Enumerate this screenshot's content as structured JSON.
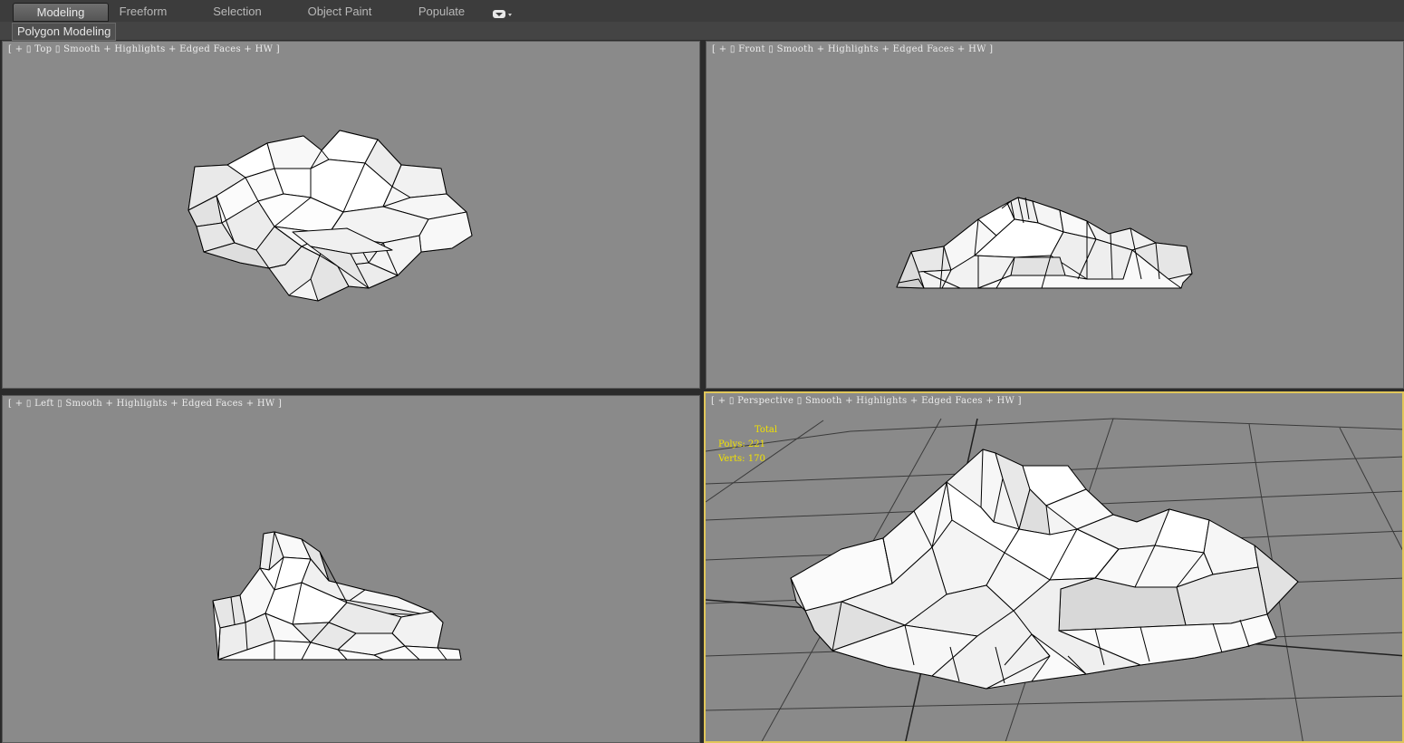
{
  "ribbon": {
    "tabs": [
      "Modeling",
      "Freeform",
      "Selection",
      "Object Paint",
      "Populate"
    ],
    "active_tab": "Modeling",
    "panel_label": "Polygon Modeling",
    "expand_icon": "dropdown-icon"
  },
  "viewports": {
    "top": {
      "bracket_open": "[",
      "plus": "+",
      "name": "Top",
      "shading": "Smooth + Highlights + Edged Faces + HW",
      "bracket_close": "]"
    },
    "front": {
      "bracket_open": "[",
      "plus": "+",
      "name": "Front",
      "shading": "Smooth + Highlights + Edged Faces + HW",
      "bracket_close": "]"
    },
    "left": {
      "bracket_open": "[",
      "plus": "+",
      "name": "Left",
      "shading": "Smooth + Highlights + Edged Faces + HW",
      "bracket_close": "]"
    },
    "perspective": {
      "bracket_open": "[",
      "plus": "+",
      "name": "Perspective",
      "shading": "Smooth + Highlights + Edged Faces + HW",
      "bracket_close": "]"
    }
  },
  "stats": {
    "title": "Total",
    "polys_label": "Polys:",
    "polys": "221",
    "verts_label": "Verts:",
    "verts": "170"
  },
  "colors": {
    "viewport_bg": "#8a8a8a",
    "active_border": "#e0c65a",
    "stats_text": "#f2e200",
    "mesh_face": "#f4f4f4",
    "mesh_edge": "#000000",
    "grid_line": "#3a3a3a"
  }
}
